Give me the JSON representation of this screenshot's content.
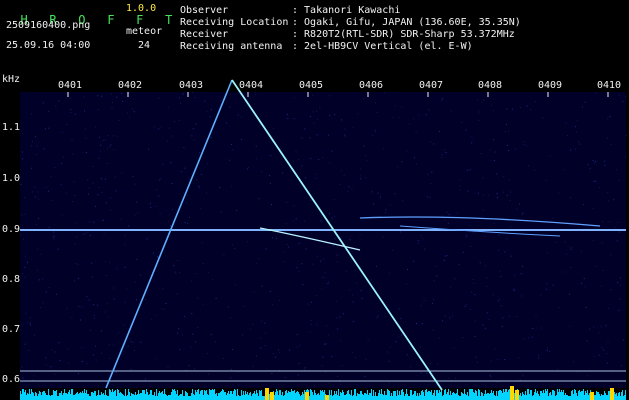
{
  "app": {
    "title_letters": [
      "H",
      "R",
      "O",
      "F",
      "F",
      "T"
    ],
    "version": "1.0.0"
  },
  "file": {
    "name": "2509160400.png",
    "datetime": "25.09.16 04:00"
  },
  "meteor": {
    "label": "meteor",
    "count": "24"
  },
  "info": {
    "rows": [
      {
        "label": "Observer",
        "value": ": Takanori Kawachi"
      },
      {
        "label": "Receiving Location",
        "value": ": Ogaki, Gifu, JAPAN (136.60E, 35.35N)"
      },
      {
        "label": "Receiver",
        "value": ": R820T2(RTL-SDR) SDR-Sharp 53.372MHz"
      },
      {
        "label": "Receiving antenna",
        "value": ": 2el-HB9CV Vertical (el. E-W)"
      }
    ]
  },
  "spectrogram": {
    "y_unit": "kHz",
    "y_ticks": [
      "1.1",
      "1.0",
      "0.9",
      "0.8",
      "0.7",
      "0.6"
    ],
    "time_ticks": [
      "0401",
      "0402",
      "0403",
      "0404",
      "0405",
      "0406",
      "0407",
      "0408",
      "0409",
      "0410"
    ],
    "colors": {
      "background": "#000028",
      "trace": "#9cf3ff",
      "level_bar": "#00d4ff",
      "peak": "#ffd700"
    }
  }
}
